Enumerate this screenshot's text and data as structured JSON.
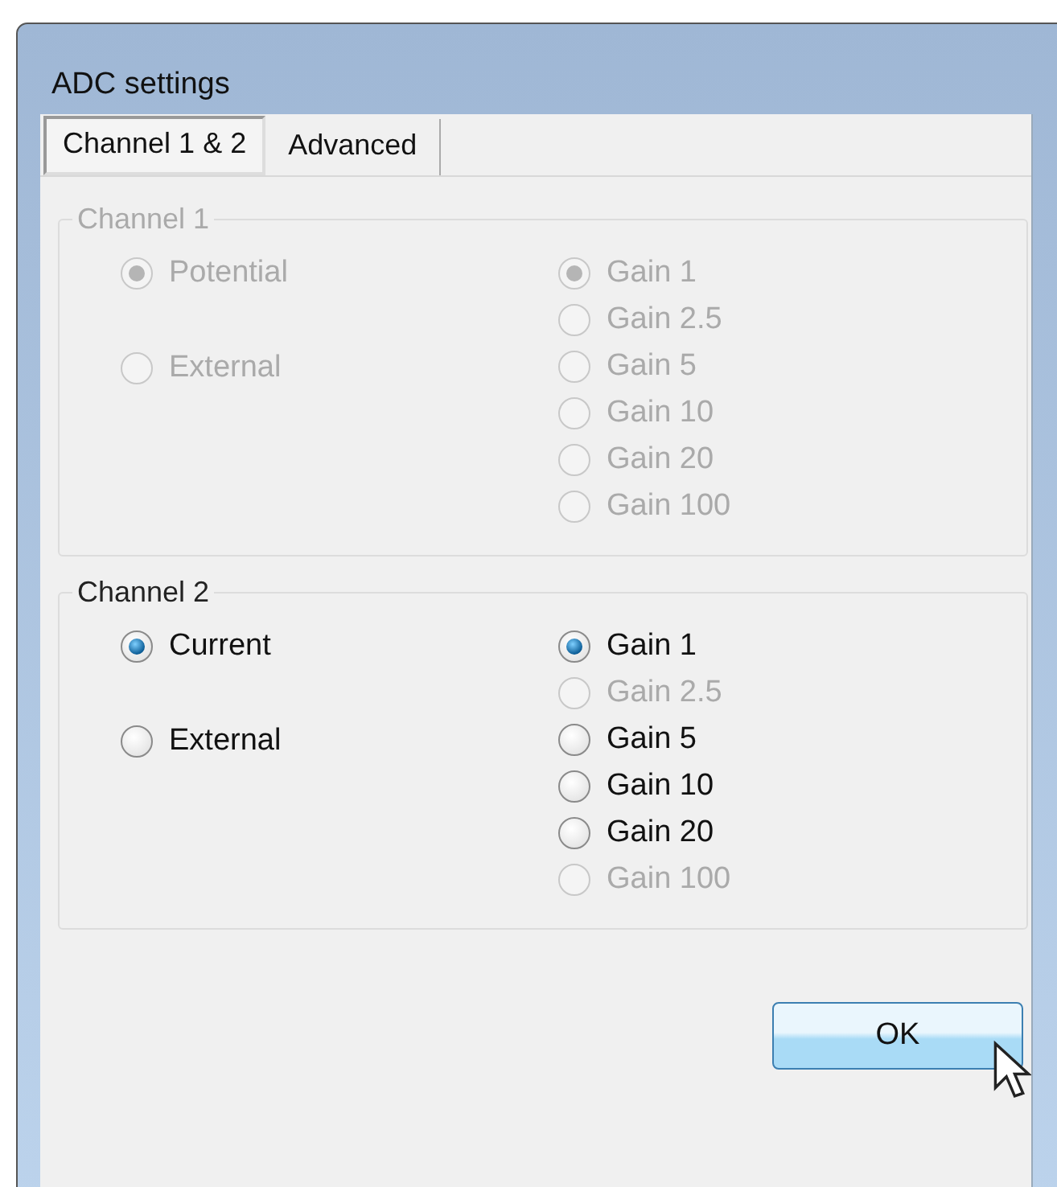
{
  "window": {
    "title": "ADC settings"
  },
  "tabs": [
    {
      "label": "Channel 1 & 2",
      "selected": true
    },
    {
      "label": "Advanced",
      "selected": false
    }
  ],
  "groups": [
    {
      "title": "Channel 1",
      "disabled": true,
      "sources": [
        {
          "label": "Potential",
          "selected": true,
          "disabled": true
        },
        {
          "label": "External",
          "selected": false,
          "disabled": true
        }
      ],
      "gains": [
        {
          "label": "Gain 1",
          "selected": true,
          "disabled": true
        },
        {
          "label": "Gain 2.5",
          "selected": false,
          "disabled": true
        },
        {
          "label": "Gain 5",
          "selected": false,
          "disabled": true
        },
        {
          "label": "Gain 10",
          "selected": false,
          "disabled": true
        },
        {
          "label": "Gain 20",
          "selected": false,
          "disabled": true
        },
        {
          "label": "Gain 100",
          "selected": false,
          "disabled": true
        }
      ]
    },
    {
      "title": "Channel 2",
      "disabled": false,
      "sources": [
        {
          "label": "Current",
          "selected": true,
          "disabled": false
        },
        {
          "label": "External",
          "selected": false,
          "disabled": false
        }
      ],
      "gains": [
        {
          "label": "Gain 1",
          "selected": true,
          "disabled": false
        },
        {
          "label": "Gain 2.5",
          "selected": false,
          "disabled": true
        },
        {
          "label": "Gain 5",
          "selected": false,
          "disabled": false
        },
        {
          "label": "Gain 10",
          "selected": false,
          "disabled": false
        },
        {
          "label": "Gain 20",
          "selected": false,
          "disabled": false
        },
        {
          "label": "Gain 100",
          "selected": false,
          "disabled": true
        }
      ]
    }
  ],
  "buttons": [
    {
      "label": "OK"
    }
  ]
}
